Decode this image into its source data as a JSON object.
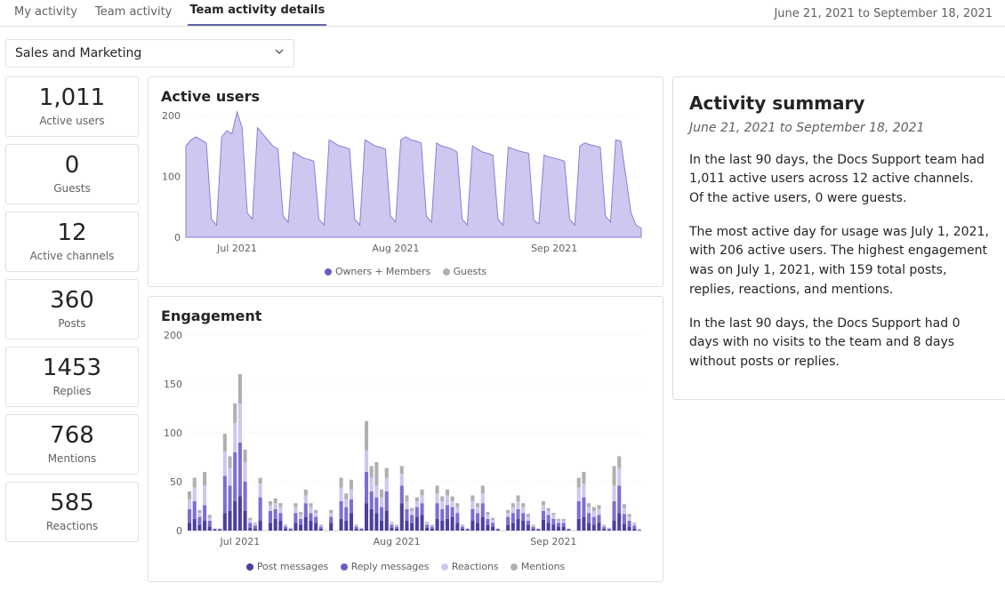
{
  "tabs": {
    "my": "My activity",
    "team": "Team activity",
    "details": "Team activity details"
  },
  "date_range": "June 21, 2021 to September 18, 2021",
  "team_selector": {
    "value": "Sales and Marketing"
  },
  "stats": {
    "active_users": {
      "value": "1,011",
      "label": "Active users"
    },
    "guests": {
      "value": "0",
      "label": "Guests"
    },
    "channels": {
      "value": "12",
      "label": "Active channels"
    },
    "posts": {
      "value": "360",
      "label": "Posts"
    },
    "replies": {
      "value": "1453",
      "label": "Replies"
    },
    "mentions": {
      "value": "768",
      "label": "Mentions"
    },
    "reactions": {
      "value": "585",
      "label": "Reactions"
    }
  },
  "charts": {
    "active": {
      "title": "Active users",
      "legend": {
        "a": "Owners + Members",
        "b": "Guests"
      }
    },
    "engage": {
      "title": "Engagement",
      "legend": {
        "a": "Post messages",
        "b": "Reply messages",
        "c": "Reactions",
        "d": "Mentions"
      }
    }
  },
  "x_labels": {
    "jul": "Jul 2021",
    "aug": "Aug 2021",
    "sep": "Sep 2021"
  },
  "summary": {
    "title": "Activity summary",
    "subtitle": "June 21, 2021 to September 18, 2021",
    "p1": "In the last 90 days, the Docs Support team had 1,011 active users across 12 active channels. Of the active users, 0 were guests.",
    "p2": "The most active day for usage was July 1, 2021, with 206 active users. The highest engagement was on July 1, 2021, with 159 total posts, replies, reactions, and mentions.",
    "p3": "In the last 90 days, the Docs Support had 0 days with no visits to the team and 8 days without posts or replies."
  },
  "chart_data": [
    {
      "type": "area",
      "title": "Active users",
      "ylabel": "",
      "ylim": [
        0,
        200
      ],
      "yticks": [
        0,
        100,
        200
      ],
      "xlabel": "",
      "xticks": [
        "Jul 2021",
        "Aug 2021",
        "Sep 2021"
      ],
      "x": [
        0,
        1,
        2,
        3,
        4,
        5,
        6,
        7,
        8,
        9,
        10,
        11,
        12,
        13,
        14,
        15,
        16,
        17,
        18,
        19,
        20,
        21,
        22,
        23,
        24,
        25,
        26,
        27,
        28,
        29,
        30,
        31,
        32,
        33,
        34,
        35,
        36,
        37,
        38,
        39,
        40,
        41,
        42,
        43,
        44,
        45,
        46,
        47,
        48,
        49,
        50,
        51,
        52,
        53,
        54,
        55,
        56,
        57,
        58,
        59,
        60,
        61,
        62,
        63,
        64,
        65,
        66,
        67,
        68,
        69,
        70,
        71,
        72,
        73,
        74,
        75,
        76,
        77,
        78,
        79,
        80,
        81,
        82,
        83,
        84,
        85,
        86,
        87,
        88,
        89
      ],
      "series": [
        {
          "name": "Owners + Members",
          "values": [
            150,
            160,
            165,
            160,
            155,
            30,
            20,
            165,
            175,
            170,
            206,
            180,
            40,
            30,
            180,
            170,
            160,
            150,
            145,
            35,
            25,
            140,
            135,
            130,
            128,
            125,
            30,
            20,
            160,
            155,
            150,
            148,
            145,
            30,
            20,
            160,
            155,
            150,
            148,
            145,
            35,
            25,
            160,
            165,
            160,
            158,
            155,
            35,
            25,
            155,
            150,
            148,
            145,
            140,
            30,
            20,
            150,
            145,
            140,
            138,
            135,
            30,
            20,
            148,
            145,
            142,
            140,
            138,
            28,
            22,
            135,
            132,
            130,
            128,
            125,
            30,
            20,
            150,
            155,
            152,
            150,
            148,
            35,
            25,
            160,
            158,
            100,
            40,
            20,
            15
          ]
        },
        {
          "name": "Guests",
          "values": [
            0,
            0,
            0,
            0,
            0,
            0,
            0,
            0,
            0,
            0,
            0,
            0,
            0,
            0,
            0,
            0,
            0,
            0,
            0,
            0,
            0,
            0,
            0,
            0,
            0,
            0,
            0,
            0,
            0,
            0,
            0,
            0,
            0,
            0,
            0,
            0,
            0,
            0,
            0,
            0,
            0,
            0,
            0,
            0,
            0,
            0,
            0,
            0,
            0,
            0,
            0,
            0,
            0,
            0,
            0,
            0,
            0,
            0,
            0,
            0,
            0,
            0,
            0,
            0,
            0,
            0,
            0,
            0,
            0,
            0,
            0,
            0,
            0,
            0,
            0,
            0,
            0,
            0,
            0,
            0,
            0,
            0,
            0,
            0,
            0,
            0,
            0,
            0,
            0,
            0
          ]
        }
      ]
    },
    {
      "type": "bar",
      "title": "Engagement",
      "ylabel": "",
      "ylim": [
        0,
        200
      ],
      "yticks": [
        0,
        50,
        100,
        150,
        200
      ],
      "xlabel": "",
      "xticks": [
        "Jul 2021",
        "Aug 2021",
        "Sep 2021"
      ],
      "categories": [
        0,
        1,
        2,
        3,
        4,
        5,
        6,
        7,
        8,
        9,
        10,
        11,
        12,
        13,
        14,
        15,
        16,
        17,
        18,
        19,
        20,
        21,
        22,
        23,
        24,
        25,
        26,
        27,
        28,
        29,
        30,
        31,
        32,
        33,
        34,
        35,
        36,
        37,
        38,
        39,
        40,
        41,
        42,
        43,
        44,
        45,
        46,
        47,
        48,
        49,
        50,
        51,
        52,
        53,
        54,
        55,
        56,
        57,
        58,
        59,
        60,
        61,
        62,
        63,
        64,
        65,
        66,
        67,
        68,
        69,
        70,
        71,
        72,
        73,
        74,
        75,
        76,
        77,
        78,
        79,
        80,
        81,
        82,
        83,
        84,
        85,
        86,
        87,
        88,
        89
      ],
      "series": [
        {
          "name": "Post messages",
          "values": [
            8,
            12,
            6,
            10,
            4,
            1,
            1,
            18,
            20,
            30,
            35,
            20,
            3,
            2,
            10,
            0,
            8,
            12,
            10,
            2,
            1,
            8,
            6,
            14,
            10,
            8,
            2,
            0,
            8,
            0,
            12,
            10,
            18,
            2,
            1,
            28,
            22,
            18,
            10,
            20,
            3,
            2,
            28,
            10,
            8,
            14,
            16,
            3,
            2,
            12,
            10,
            12,
            14,
            8,
            2,
            1,
            10,
            8,
            14,
            6,
            4,
            1,
            0,
            6,
            8,
            12,
            10,
            6,
            2,
            1,
            11,
            8,
            6,
            4,
            4,
            1,
            0,
            12,
            14,
            8,
            6,
            8,
            2,
            1,
            10,
            18,
            7,
            4,
            2,
            0
          ]
        },
        {
          "name": "Reply messages",
          "values": [
            14,
            18,
            8,
            16,
            6,
            1,
            1,
            38,
            26,
            50,
            55,
            30,
            5,
            3,
            24,
            0,
            12,
            10,
            8,
            2,
            1,
            10,
            6,
            14,
            8,
            6,
            2,
            0,
            6,
            0,
            18,
            14,
            14,
            2,
            1,
            32,
            18,
            16,
            14,
            20,
            3,
            2,
            18,
            12,
            8,
            10,
            12,
            3,
            2,
            16,
            12,
            14,
            10,
            10,
            2,
            1,
            12,
            10,
            14,
            6,
            4,
            1,
            0,
            8,
            10,
            10,
            8,
            4,
            2,
            1,
            9,
            8,
            6,
            4,
            4,
            1,
            0,
            18,
            20,
            10,
            8,
            8,
            2,
            1,
            20,
            28,
            10,
            6,
            3,
            1
          ]
        },
        {
          "name": "Reactions",
          "values": [
            10,
            14,
            4,
            20,
            3,
            0,
            0,
            25,
            18,
            30,
            40,
            20,
            3,
            2,
            14,
            0,
            6,
            6,
            6,
            1,
            1,
            6,
            4,
            8,
            6,
            4,
            1,
            0,
            4,
            0,
            14,
            8,
            10,
            1,
            1,
            22,
            14,
            12,
            10,
            14,
            2,
            1,
            12,
            8,
            4,
            6,
            8,
            2,
            1,
            10,
            8,
            10,
            6,
            6,
            1,
            0,
            8,
            6,
            10,
            4,
            3,
            0,
            0,
            4,
            6,
            8,
            6,
            4,
            1,
            0,
            6,
            4,
            4,
            2,
            2,
            0,
            0,
            14,
            14,
            6,
            6,
            6,
            1,
            1,
            16,
            18,
            6,
            4,
            2,
            1
          ]
        },
        {
          "name": "Mentions",
          "values": [
            8,
            10,
            3,
            14,
            3,
            0,
            0,
            18,
            12,
            20,
            30,
            13,
            2,
            1,
            6,
            0,
            4,
            5,
            4,
            1,
            0,
            4,
            3,
            6,
            4,
            3,
            1,
            0,
            3,
            0,
            10,
            6,
            10,
            1,
            0,
            30,
            12,
            24,
            8,
            10,
            1,
            1,
            8,
            6,
            3,
            4,
            6,
            1,
            1,
            8,
            5,
            6,
            5,
            4,
            1,
            0,
            6,
            4,
            8,
            3,
            2,
            0,
            0,
            3,
            4,
            6,
            4,
            3,
            1,
            0,
            4,
            3,
            2,
            2,
            2,
            0,
            0,
            10,
            12,
            4,
            4,
            4,
            1,
            0,
            20,
            12,
            4,
            3,
            1,
            0
          ]
        }
      ]
    }
  ]
}
